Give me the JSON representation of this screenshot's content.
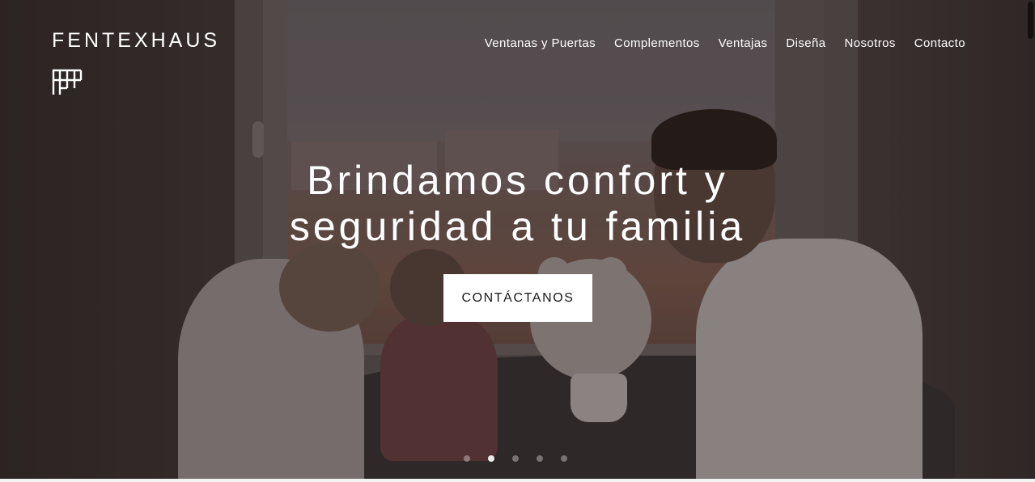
{
  "brand": {
    "name": "FENTEXHAUS",
    "logo_icon": "fentexhaus-logo-icon"
  },
  "nav": {
    "items": [
      {
        "label": "Ventanas y Puertas"
      },
      {
        "label": "Complementos"
      },
      {
        "label": "Ventajas"
      },
      {
        "label": "Diseña"
      },
      {
        "label": "Nosotros"
      },
      {
        "label": "Contacto"
      }
    ]
  },
  "hero": {
    "headline_line1": "Brindamos confort y",
    "headline_line2": "seguridad a tu familia",
    "cta_label": "CONTÁCTANOS",
    "slides": {
      "count": 5,
      "active": 2
    }
  },
  "colors": {
    "text": "#ffffff",
    "cta_background": "#ffffff",
    "cta_text": "#1a1a1a"
  }
}
